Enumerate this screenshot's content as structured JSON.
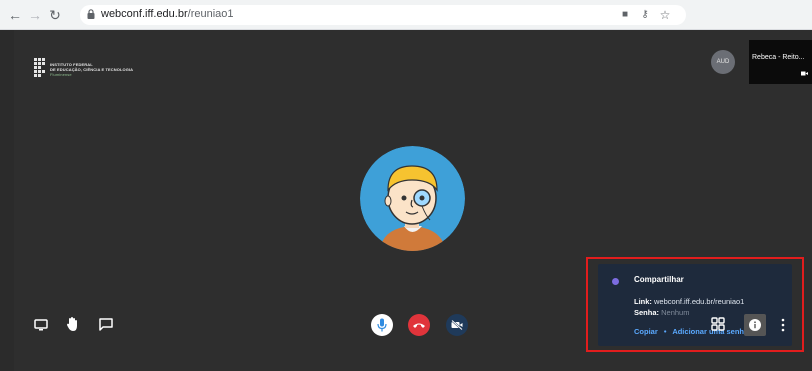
{
  "browser": {
    "url_domain": "webconf.iff.edu.br",
    "url_path": "/reuniao1",
    "icons": [
      "back-icon",
      "forward-icon",
      "reload-icon",
      "lock-icon",
      "camera-blocked-icon",
      "key-icon",
      "star-icon"
    ]
  },
  "logo": {
    "line1": "INSTITUTO FEDERAL",
    "line2": "DE EDUCAÇÃO, CIÊNCIA E TECNOLOGIA",
    "line3": "Fluminense"
  },
  "participants": {
    "avatar_initials": "AUD",
    "thumbnail_name": "Rebeca - Reito..."
  },
  "share_panel": {
    "title": "Compartilhar",
    "link_label": "Link:",
    "link_value": "webconf.iff.edu.br/reuniao1",
    "password_label": "Senha:",
    "password_value": "Nenhum",
    "copy_label": "Copiar",
    "separator": "•",
    "add_password_label": "Adicionar uma senha"
  },
  "colors": {
    "highlight_border": "#e21d1d",
    "link_blue": "#5aa9ff",
    "hangup_red": "#e0343b",
    "avatar_bg": "#3ea0d8"
  }
}
